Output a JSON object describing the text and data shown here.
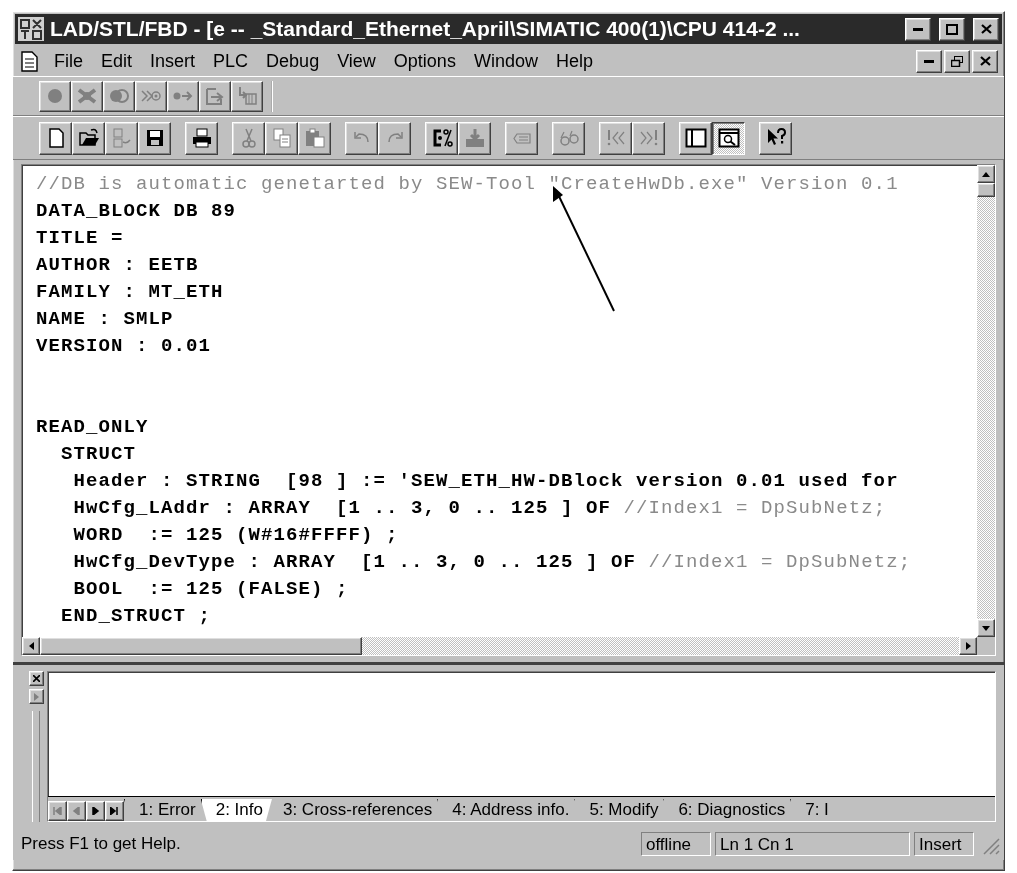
{
  "window": {
    "title": "LAD/STL/FBD  - [e -- _Standard_Ethernet_April\\SIMATIC 400(1)\\CPU 414-2 ..."
  },
  "menu": [
    "File",
    "Edit",
    "Insert",
    "PLC",
    "Debug",
    "View",
    "Options",
    "Window",
    "Help"
  ],
  "toolbar_1": [
    {
      "disabled": true
    },
    {
      "disabled": true
    },
    {
      "disabled": true
    },
    {
      "disabled": true
    },
    {
      "disabled": true
    },
    {
      "disabled": true
    },
    {
      "disabled": true
    }
  ],
  "toolbar_2": [
    {
      "disabled": false,
      "pressed": false
    },
    {
      "disabled": false,
      "pressed": false
    },
    {
      "disabled": true,
      "pressed": false
    },
    {
      "disabled": false,
      "pressed": false
    },
    {
      "disabled": false,
      "pressed": false
    },
    {
      "disabled": true,
      "pressed": false
    },
    {
      "disabled": true,
      "pressed": false
    },
    {
      "disabled": true,
      "pressed": false
    },
    {
      "disabled": true,
      "pressed": false
    },
    {
      "disabled": true,
      "pressed": false
    },
    {
      "disabled": false,
      "pressed": false
    },
    {
      "disabled": true,
      "pressed": false
    },
    {
      "disabled": true,
      "pressed": false
    },
    {
      "disabled": true,
      "pressed": false
    },
    {
      "disabled": true,
      "pressed": false
    },
    {
      "disabled": true,
      "pressed": false
    },
    {
      "disabled": false,
      "pressed": false
    },
    {
      "disabled": false,
      "pressed": true
    },
    {
      "disabled": false,
      "pressed": false
    }
  ],
  "editor": {
    "blocks": [
      [
        [
          {
            "kind": "comment",
            "text": "//DB is automatic genetarted by SEW-Tool \"CreateHwDb.exe\" Version 0.1"
          }
        ],
        [
          {
            "kind": "code",
            "text": "DATA_BLOCK DB 89"
          }
        ],
        [
          {
            "kind": "code",
            "text": "TITLE ="
          }
        ],
        [
          {
            "kind": "code",
            "text": "AUTHOR : EETB"
          }
        ],
        [
          {
            "kind": "code",
            "text": "FAMILY : MT_ETH"
          }
        ],
        [
          {
            "kind": "code",
            "text": "NAME : SMLP"
          }
        ],
        [
          {
            "kind": "code",
            "text": "VERSION : 0.01"
          }
        ]
      ],
      [
        [
          {
            "kind": "code",
            "text": "READ_ONLY"
          }
        ],
        [
          {
            "kind": "code",
            "text": "  STRUCT"
          }
        ],
        [
          {
            "kind": "code",
            "text": "   Header : STRING  [98 ] := 'SEW_ETH_HW-DBlock version 0.01 used for"
          }
        ],
        [
          {
            "kind": "code",
            "text": "   HwCfg_LAddr : ARRAY  [1 .. 3, 0 .. 125 ] OF "
          },
          {
            "kind": "comment",
            "text": "//Index1 = DpSubNetz;"
          }
        ],
        [
          {
            "kind": "code",
            "text": "   WORD  := 125 (W#16#FFFF) ;"
          }
        ],
        [
          {
            "kind": "code",
            "text": "   HwCfg_DevType : ARRAY  [1 .. 3, 0 .. 125 ] OF "
          },
          {
            "kind": "comment",
            "text": "//Index1 = DpSubNetz;"
          }
        ],
        [
          {
            "kind": "code",
            "text": "   BOOL  := 125 (FALSE) ;"
          }
        ],
        [
          {
            "kind": "code",
            "text": "  END_STRUCT ;"
          }
        ]
      ]
    ]
  },
  "output_tabs": [
    {
      "label": "1: Error",
      "selected": false
    },
    {
      "label": "2: Info",
      "selected": true
    },
    {
      "label": "3: Cross-references",
      "selected": false
    },
    {
      "label": "4: Address info.",
      "selected": false
    },
    {
      "label": "5: Modify",
      "selected": false
    },
    {
      "label": "6: Diagnostics",
      "selected": false
    },
    {
      "label": "7: I",
      "selected": false
    }
  ],
  "status_bar": {
    "message": "Press F1 to get Help.",
    "mode": "offline",
    "position": "Ln 1 Cn 1",
    "insert": "Insert"
  }
}
